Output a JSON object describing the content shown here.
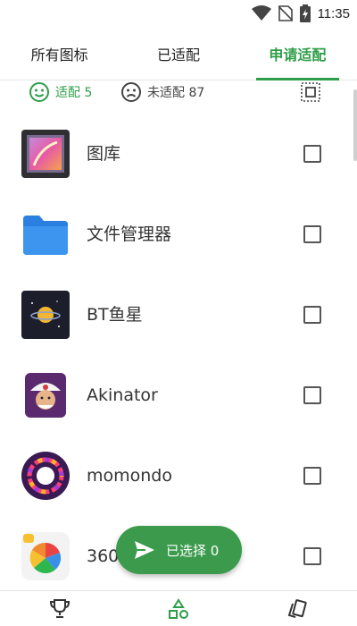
{
  "status_bar": {
    "time": "11:35",
    "icons": [
      "wifi-icon",
      "no-sim-icon",
      "battery-charging-icon"
    ]
  },
  "tabs": [
    {
      "label": "所有图标",
      "active": false
    },
    {
      "label": "已适配",
      "active": false
    },
    {
      "label": "申请适配",
      "active": true
    }
  ],
  "summary": {
    "adapted_label": "适配 5",
    "unadapted_label": "未适配 87"
  },
  "apps": [
    {
      "name": "图库",
      "icon": "gallery-icon",
      "checked": false
    },
    {
      "name": "文件管理器",
      "icon": "folder-icon",
      "checked": false
    },
    {
      "name": "BT鱼星",
      "icon": "planet-icon",
      "checked": false
    },
    {
      "name": "Akinator",
      "icon": "akinator-icon",
      "checked": false
    },
    {
      "name": "momondo",
      "icon": "momondo-icon",
      "checked": false
    },
    {
      "name": "360",
      "icon": "360-icon",
      "checked": false
    }
  ],
  "fab": {
    "label": "已选择 0",
    "icon": "send-icon"
  },
  "bottom_nav": [
    "trophy-icon",
    "shapes-icon",
    "cards-icon"
  ],
  "colors": {
    "accent": "#2e9e48",
    "fab": "#3b9a4c"
  }
}
